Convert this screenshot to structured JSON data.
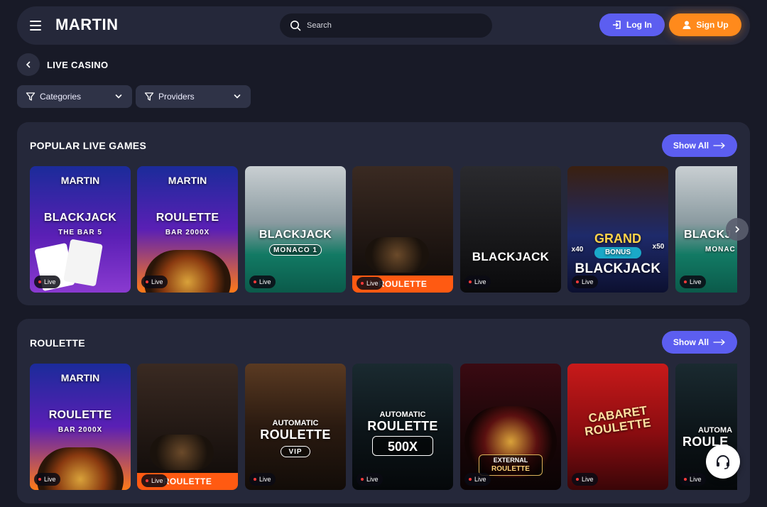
{
  "header": {
    "brand": "MARTIN",
    "search_placeholder": "Search",
    "login_label": "Log In",
    "signup_label": "Sign Up"
  },
  "page": {
    "title": "LIVE CASINO"
  },
  "filters": {
    "categories_label": "Categories",
    "providers_label": "Providers"
  },
  "sections": [
    {
      "title": "POPULAR LIVE GAMES",
      "show_all_label": "Show All",
      "games": [
        {
          "brand": "MARTIN",
          "name": "BLACKJACK",
          "sub": "THE BAR 5",
          "badge": "Live"
        },
        {
          "brand": "MARTIN",
          "name": "ROULETTE",
          "sub": "BAR 2000X",
          "badge": "Live"
        },
        {
          "name": "BLACKJACK",
          "sub": "MONACO 1",
          "badge": "Live"
        },
        {
          "strip": "ROULETTE",
          "badge": "Live"
        },
        {
          "name": "BLACKJACK",
          "badge": "Live"
        },
        {
          "top": "GRAND",
          "mid": "BONUS",
          "name": "BLACKJACK",
          "left_mult": "x40",
          "right_mult": "x50",
          "badge": "Live"
        },
        {
          "name": "BLACKJ",
          "sub": "MONAC",
          "badge": "Live"
        }
      ]
    },
    {
      "title": "ROULETTE",
      "show_all_label": "Show All",
      "games": [
        {
          "brand": "MARTIN",
          "name": "ROULETTE",
          "sub": "BAR 2000X",
          "badge": "Live"
        },
        {
          "strip": "ROULETTE",
          "badge": "Live"
        },
        {
          "top": "AUTOMATIC",
          "name": "ROULETTE",
          "sub": "VIP",
          "badge": "Live"
        },
        {
          "top": "AUTOMATIC",
          "name": "ROULETTE",
          "sub": "500X",
          "badge": "Live"
        },
        {
          "top": "EXTERNAL",
          "name": "ROULETTE",
          "badge": "Live"
        },
        {
          "top": "CABARET",
          "name": "ROULETTE",
          "badge": "Live"
        },
        {
          "top": "AUTOMA",
          "name": "ROULE",
          "badge": "Live"
        }
      ]
    }
  ],
  "colors": {
    "accent_blue": "#5c5ef0",
    "accent_orange": "#ff8a1c",
    "background": "#181a27",
    "panel": "#25283a"
  }
}
